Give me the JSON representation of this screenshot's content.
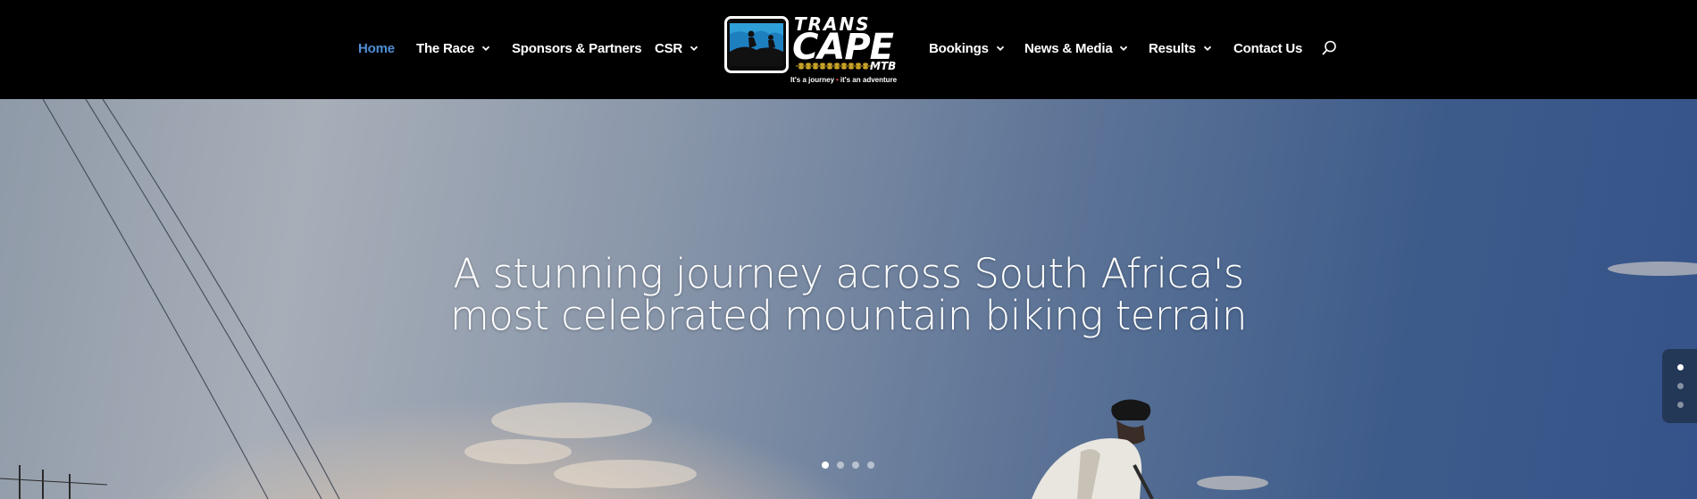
{
  "nav": {
    "left": [
      {
        "label": "Home",
        "active": true,
        "dropdown": false
      },
      {
        "label": "The Race",
        "active": false,
        "dropdown": true
      },
      {
        "label": "Sponsors & Partners",
        "active": false,
        "dropdown": false
      },
      {
        "label": "CSR",
        "active": false,
        "dropdown": true
      }
    ],
    "right": [
      {
        "label": "Bookings",
        "dropdown": true
      },
      {
        "label": "News & Media",
        "dropdown": true
      },
      {
        "label": "Results",
        "dropdown": true
      },
      {
        "label": "Contact Us",
        "dropdown": false
      }
    ],
    "search_icon": "search-icon",
    "active_color": "#4d8fd6"
  },
  "logo": {
    "line1": "TRANS",
    "line2": "CAPE",
    "line3": "MTB",
    "tagline_a": "It's a journey",
    "tagline_b": "it's an adventure",
    "tagline_sep": "•"
  },
  "hero": {
    "title_line1": "A stunning journey across South Africa's",
    "title_line2": "most celebrated mountain biking terrain",
    "slide_count": 4,
    "active_slide": 1
  },
  "side_nav": {
    "dots": 3,
    "active": 1
  }
}
